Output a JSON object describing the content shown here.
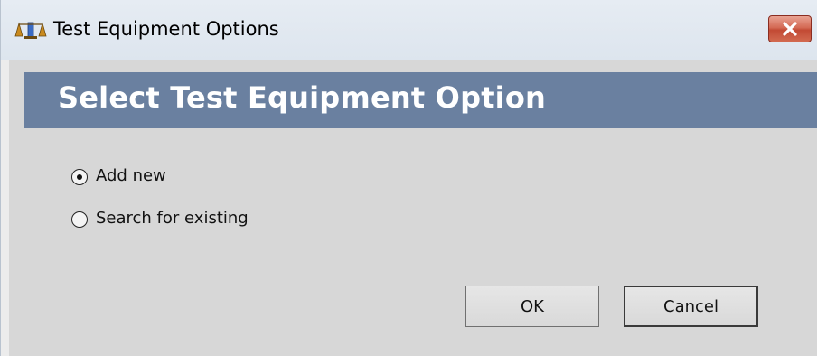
{
  "window": {
    "title": "Test Equipment Options",
    "icon": "scale-icon",
    "close_icon": "close-icon"
  },
  "header": {
    "title": "Select Test Equipment Option"
  },
  "options": [
    {
      "label": "Add new",
      "selected": true
    },
    {
      "label": "Search for existing",
      "selected": false
    }
  ],
  "buttons": {
    "ok_label": "OK",
    "cancel_label": "Cancel"
  },
  "colors": {
    "banner": "#6a80a0",
    "close_button": "#c24a34",
    "client_background": "#d7d7d7"
  }
}
